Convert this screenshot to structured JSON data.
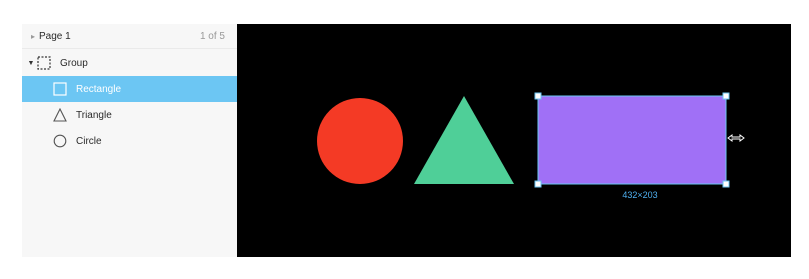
{
  "sidebar": {
    "page": {
      "label": "Page 1",
      "count": "1 of 5"
    },
    "layers": {
      "group": "Group",
      "rectangle": "Rectangle",
      "triangle": "Triangle",
      "circle": "Circle"
    }
  },
  "canvas": {
    "dimensions_label": "432×203",
    "colors": {
      "background": "#000000",
      "circle": "#f43a25",
      "triangle": "#4fcf98",
      "rectangle": "#a070f6",
      "selection": "#6cc6f3"
    }
  },
  "icons": {
    "page_chevron": "chevron-right-icon",
    "group_caret": "caret-down-icon",
    "group": "group-frame-icon",
    "rectangle": "rectangle-icon",
    "triangle": "triangle-icon",
    "circle": "circle-icon",
    "resize_cursor": "resize-horizontal-cursor-icon"
  }
}
